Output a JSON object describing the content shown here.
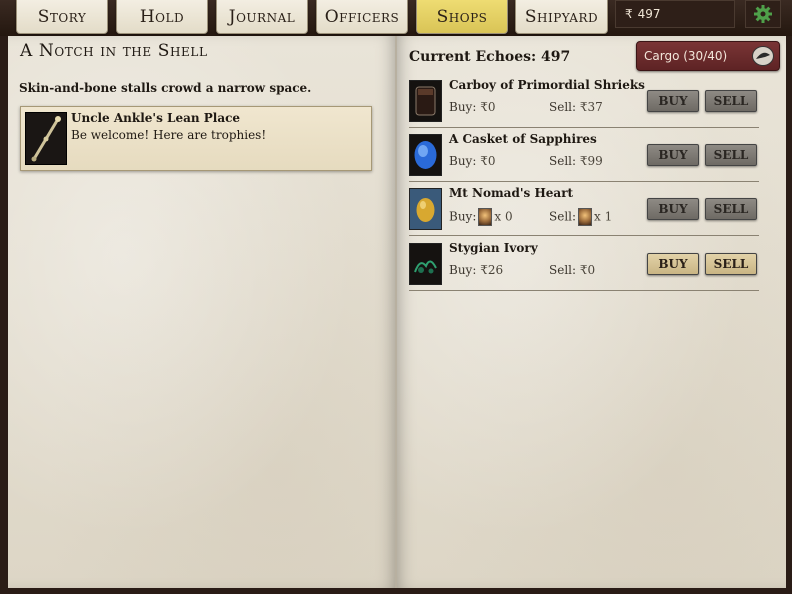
{
  "tabs": [
    {
      "label": "Story",
      "active": false
    },
    {
      "label": "Hold",
      "active": false
    },
    {
      "label": "Journal",
      "active": false
    },
    {
      "label": "Officers",
      "active": false
    },
    {
      "label": "Shops",
      "active": true
    },
    {
      "label": "Shipyard",
      "active": false
    }
  ],
  "topbar": {
    "echoes_value": "497",
    "currency_symbol": "₹",
    "settings_icon": "gear-icon"
  },
  "left_page": {
    "title": "A Notch in the Shell",
    "description": "Skin-and-bone stalls crowd a narrow space.",
    "vendor": {
      "name": "Uncle Ankle's Lean Place",
      "greeting": "Be welcome! Here are trophies!",
      "icon": "bone-staff-icon"
    }
  },
  "right_page": {
    "current_echoes": "Current Echoes: 497",
    "cargo_label": "Cargo (30/40)",
    "cargo_icon": "cargo-icon",
    "buy_label": "Buy:",
    "sell_label": "Sell:",
    "buy_button": "BUY",
    "sell_button": "SELL",
    "items": [
      {
        "name": "Carboy of Primordial Shrieks",
        "icon": "carboy-icon",
        "buy": "₹0",
        "sell": "₹37",
        "enabled": false
      },
      {
        "name": "A Casket of Sapphires",
        "icon": "sapphire-icon",
        "buy": "₹0",
        "sell": "₹99",
        "enabled": false
      },
      {
        "name": "Mt Nomad's Heart",
        "icon": "egg-icon",
        "buy": "x 0",
        "sell": "x 1",
        "enabled": false
      },
      {
        "name": "Stygian Ivory",
        "icon": "ivory-icon",
        "buy": "₹26",
        "sell": "₹0",
        "enabled": true
      }
    ]
  }
}
